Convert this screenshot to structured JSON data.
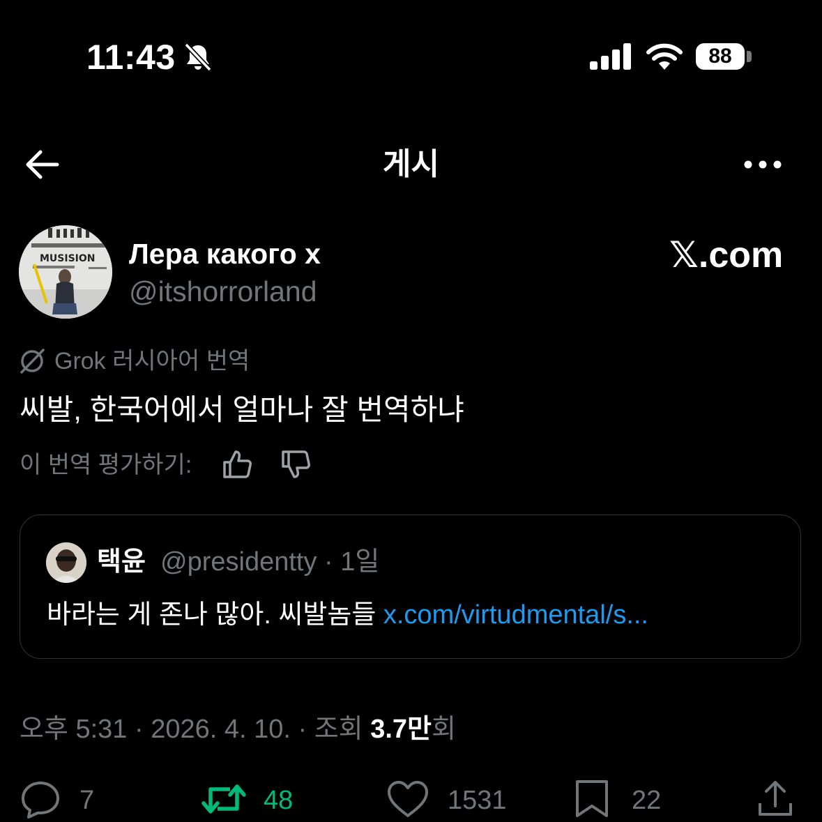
{
  "status_bar": {
    "time": "11:43",
    "battery": "88",
    "icons": [
      "bell-slash-icon",
      "cellular-signal-icon",
      "wifi-icon",
      "battery-icon"
    ]
  },
  "header": {
    "title": "게시",
    "back_icon": "arrow-left-icon",
    "more_icon": "more-horizontal-icon"
  },
  "post": {
    "author_name": "Лера какого х",
    "author_handle": "@itshorrorland",
    "source": "𝕏.com",
    "translation_label": "Grok 러시아어 번역",
    "text": "씨발, 한국어에서 얼마나 잘 번역하냐",
    "rate_label": "이 번역 평가하기:",
    "avatar_sign_text": "MUSISION",
    "quote": {
      "author_name": "택윤",
      "meta": "@presidentty · 1일",
      "text": "바라는 게 존나 많아. 씨발놈들 ",
      "link": "x.com/virtudmental/s..."
    },
    "timestamp_prefix": "오후 5:31 · 2026. 4. 10. · 조회 ",
    "views": "3.7만",
    "views_suffix": "회"
  },
  "actions": {
    "replies": "7",
    "reposts": "48",
    "likes": "1531",
    "bookmarks": "22"
  },
  "colors": {
    "background": "#000000",
    "text": "#e7e9ea",
    "muted": "#71767b",
    "link": "#1d9bf0",
    "repost_active": "#00ba7c",
    "border": "#2f3336"
  }
}
